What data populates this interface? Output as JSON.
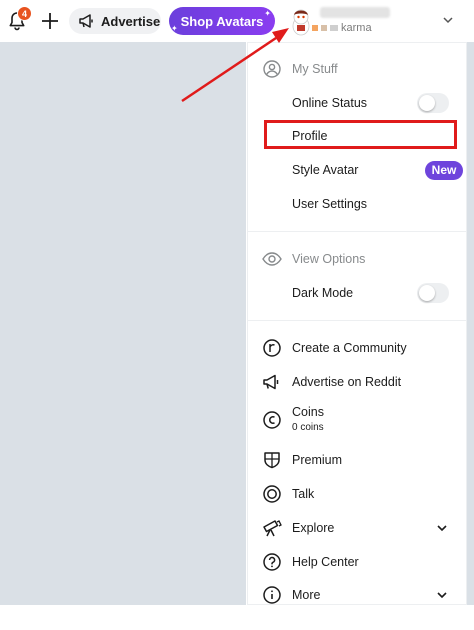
{
  "header": {
    "notification_count": "4",
    "advertise_label": "Advertise",
    "shop_label": "Shop Avatars",
    "karma_label": "karma"
  },
  "menu": {
    "sections": {
      "my_stuff": "My Stuff",
      "view_options": "View Options"
    },
    "items": {
      "online_status": "Online Status",
      "profile": "Profile",
      "style_avatar": "Style Avatar",
      "new_badge": "New",
      "user_settings": "User Settings",
      "dark_mode": "Dark Mode",
      "create_community": "Create a Community",
      "advertise_on_reddit": "Advertise on Reddit",
      "coins": "Coins",
      "coins_sub": "0 coins",
      "premium": "Premium",
      "talk": "Talk",
      "explore": "Explore",
      "help_center": "Help Center",
      "more": "More"
    },
    "toggles": {
      "online_status": false,
      "dark_mode": false
    }
  },
  "colors": {
    "accent_purple": "#6e44dc",
    "highlight_red": "#e01b1b",
    "badge_orange": "#e8531f",
    "backdrop": "#dae0e6"
  }
}
